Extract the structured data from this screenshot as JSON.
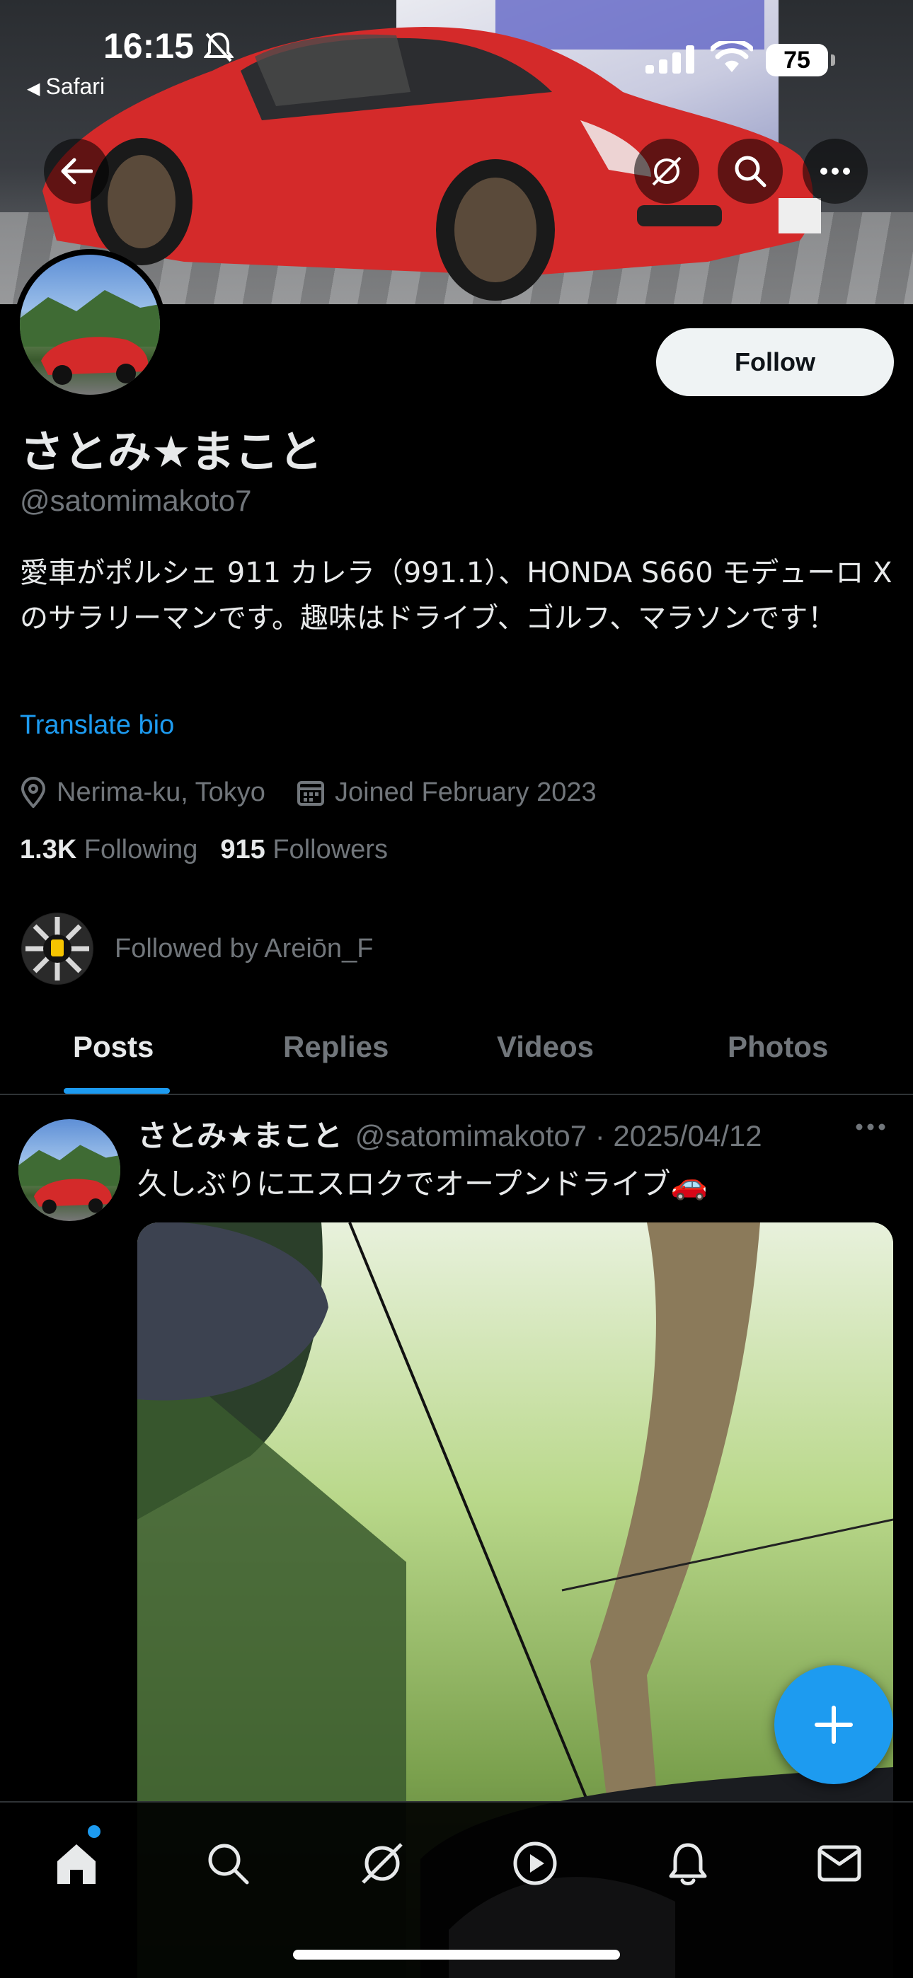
{
  "status_bar": {
    "time": "16:15",
    "back_app": "Safari",
    "battery": "75"
  },
  "banner": {
    "back_icon": "arrow-left-icon",
    "grok_icon": "grok-icon",
    "search_icon": "search-icon",
    "more_icon": "more-horizontal-icon"
  },
  "profile": {
    "follow_label": "Follow",
    "display_name": "さとみ★まこと",
    "handle": "@satomimakoto7",
    "bio": "愛車がポルシェ 911 カレラ（991.1）、HONDA S660 モデューロ X のサラリーマンです。趣味はドライブ、ゴルフ、マラソンです！",
    "translate_label": "Translate bio",
    "location": "Nerima-ku, Tokyo",
    "joined": "Joined February 2023",
    "following_count": "1.3K",
    "following_label": "Following",
    "followers_count": "915",
    "followers_label": "Followers",
    "followed_by": "Followed by Areiōn_F"
  },
  "tabs": [
    {
      "label": "Posts",
      "active": true
    },
    {
      "label": "Replies",
      "active": false
    },
    {
      "label": "Videos",
      "active": false
    },
    {
      "label": "Photos",
      "active": false
    }
  ],
  "post": {
    "name": "さとみ★まこと",
    "meta": "@satomimakoto7 · 2025/04/12",
    "text": "久しぶりにエスロクでオープンドライブ🚗"
  },
  "bottom_nav": [
    {
      "icon": "home-icon",
      "active": true
    },
    {
      "icon": "search-icon"
    },
    {
      "icon": "grok-icon"
    },
    {
      "icon": "play-icon"
    },
    {
      "icon": "bell-icon"
    },
    {
      "icon": "mail-icon"
    }
  ],
  "colors": {
    "accent": "#1d9bf0",
    "background": "#000000",
    "secondary_text": "#71767b"
  }
}
